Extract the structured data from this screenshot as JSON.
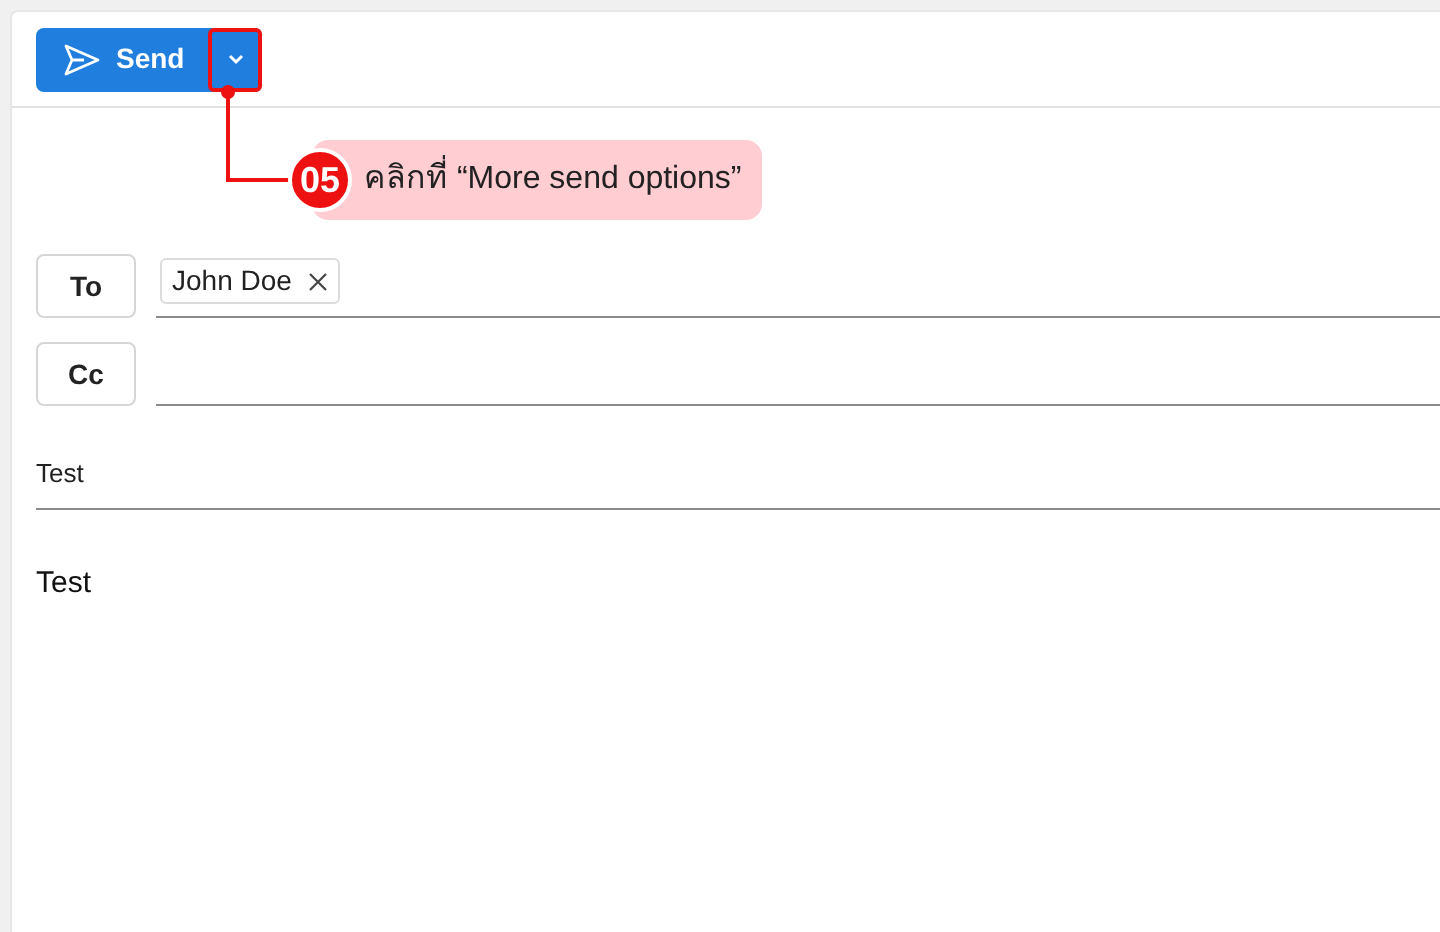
{
  "toolbar": {
    "send_button": {
      "label": "Send"
    },
    "more_send_options": {
      "highlighted": true
    }
  },
  "callout": {
    "step": "05",
    "text": "คลิกที่ “More send options”"
  },
  "recipients": [
    {
      "label": "To",
      "chips": [
        "John Doe"
      ]
    },
    {
      "label": "Cc"
    }
  ],
  "subject": {
    "value": "Test"
  },
  "body": {
    "text": "Test"
  }
}
